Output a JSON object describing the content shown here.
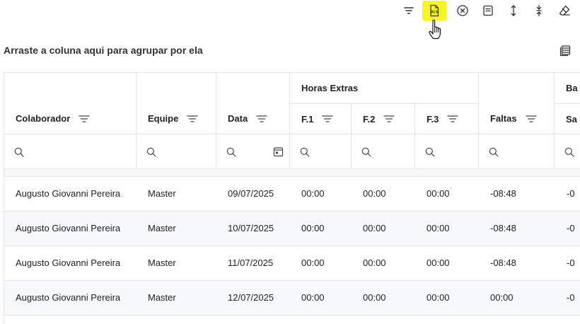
{
  "toolbar": {
    "buttons": [
      {
        "name": "filter-toggle-button",
        "icon": "filter-lines-icon"
      },
      {
        "name": "export-xls-button",
        "icon": "xls-file-icon",
        "icon_text": "XLS",
        "active": true
      },
      {
        "name": "clear-button",
        "icon": "close-circle-icon"
      },
      {
        "name": "summary-button",
        "icon": "note-icon"
      },
      {
        "name": "expand-rows-button",
        "icon": "expand-vertical-icon"
      },
      {
        "name": "collapse-rows-button",
        "icon": "collapse-vertical-icon"
      },
      {
        "name": "eraser-button",
        "icon": "eraser-icon"
      }
    ],
    "highlight_color": "#f7f71e"
  },
  "group_hint": "Arraste a coluna aqui para agrupar por ela",
  "column_chooser_icon": "column-chooser-icon",
  "header": {
    "group_horas_extras": "Horas Extras",
    "group_partial": "Ba",
    "columns": {
      "colaborador": "Colaborador",
      "equipe": "Equipe",
      "data": "Data",
      "f1": "F.1",
      "f2": "F.2",
      "f3": "F.3",
      "faltas": "Faltas",
      "partial": "Sa"
    }
  },
  "rows": [
    {
      "colaborador": "Augusto Giovanni Pereira",
      "equipe": "Master",
      "data": "09/07/2025",
      "f1": "00:00",
      "f2": "00:00",
      "f3": "00:00",
      "faltas": "-08:48",
      "partial": "-0"
    },
    {
      "colaborador": "Augusto Giovanni Pereira",
      "equipe": "Master",
      "data": "10/07/2025",
      "f1": "00:00",
      "f2": "00:00",
      "f3": "00:00",
      "faltas": "-08:48",
      "partial": "-0"
    },
    {
      "colaborador": "Augusto Giovanni Pereira",
      "equipe": "Master",
      "data": "11/07/2025",
      "f1": "00:00",
      "f2": "00:00",
      "f3": "00:00",
      "faltas": "-08:48",
      "partial": "-0"
    },
    {
      "colaborador": "Augusto Giovanni Pereira",
      "equipe": "Master",
      "data": "12/07/2025",
      "f1": "00:00",
      "f2": "00:00",
      "f3": "00:00",
      "faltas": "00:00",
      "partial": "-0"
    }
  ]
}
